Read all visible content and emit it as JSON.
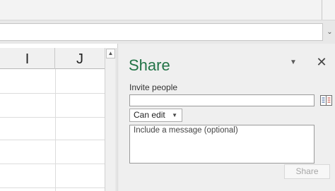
{
  "grid": {
    "columns": [
      "I",
      "J"
    ]
  },
  "share_pane": {
    "title": "Share",
    "menu_icon": "chevron-down-icon",
    "close_icon": "close-icon",
    "close_glyph": "✕",
    "invite_label": "Invite people",
    "invite_value": "",
    "address_book_icon": "address-book-icon",
    "permission": "Can edit",
    "message_placeholder": "Include a message (optional)",
    "share_button": "Share"
  },
  "colors": {
    "title": "#217346",
    "pane_background": "#efefef",
    "disabled_text": "#a6a6a6"
  }
}
